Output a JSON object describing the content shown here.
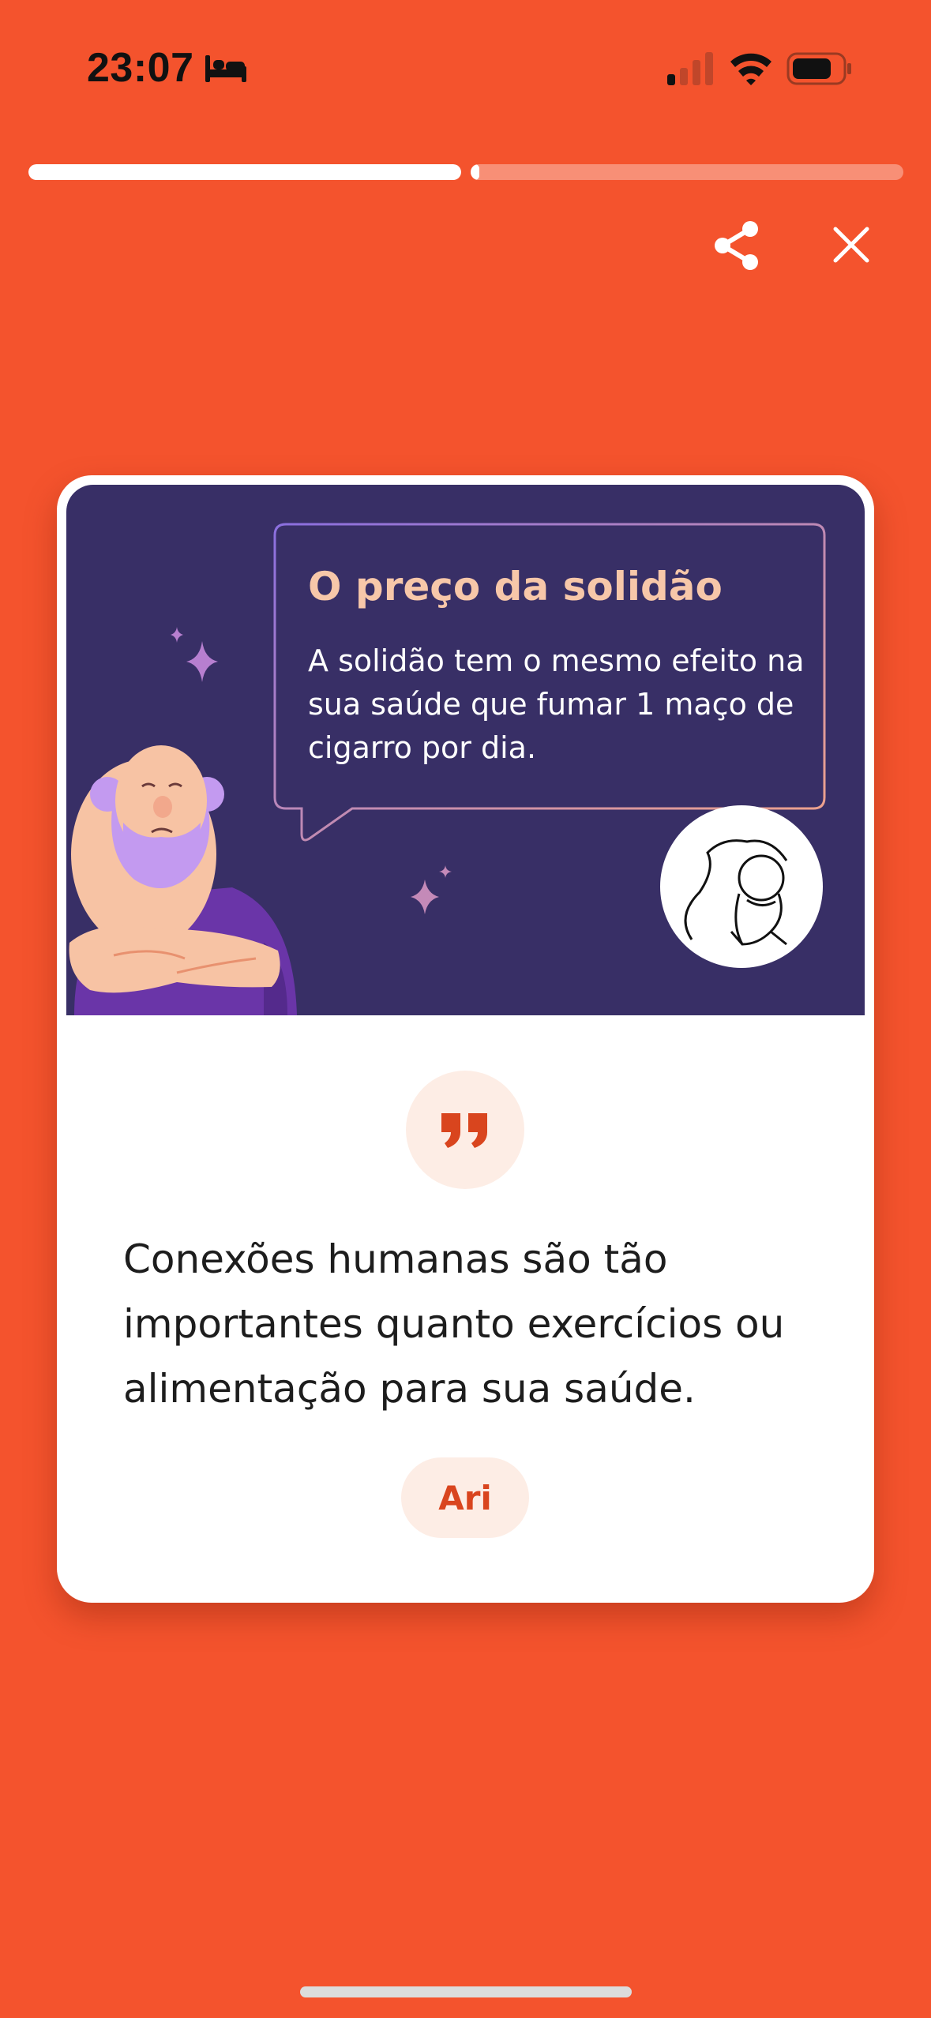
{
  "status_bar": {
    "time": "23:07",
    "icons": [
      "bed-icon",
      "cellular-signal-icon",
      "wifi-icon",
      "battery-icon"
    ]
  },
  "story_progress": {
    "segments": [
      {
        "fill_fraction": 1.0
      },
      {
        "fill_fraction": 0.02
      }
    ]
  },
  "toolbar": {
    "share_icon": "share-icon",
    "close_icon": "close-icon"
  },
  "card": {
    "hero": {
      "title": "O preço da solidão",
      "text": "A solidão tem o mesmo efeito na sua saúde que fumar 1 maço de cigarro por dia."
    },
    "quote_icon": "quote-icon",
    "quote": "Conexões humanas são tão importantes quanto exercícios ou alimentação para sua saúde.",
    "author": "Ari"
  },
  "colors": {
    "background": "#F4532D",
    "hero_bg": "#382F66",
    "hero_title": "#F7C7A9",
    "accent": "#D9451E",
    "badge_bg": "#FDEDE5"
  }
}
